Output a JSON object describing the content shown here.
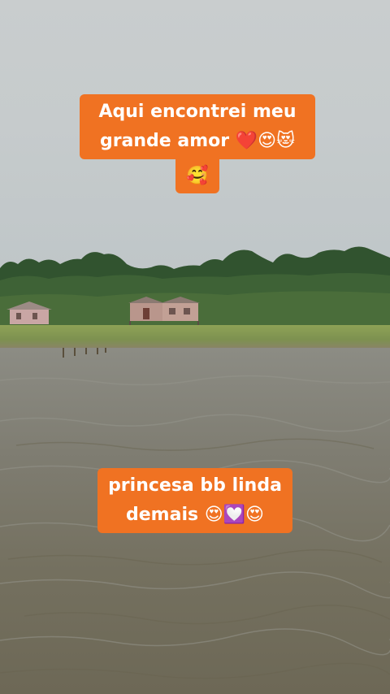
{
  "captions": {
    "top_line1": "Aqui encontrei meu",
    "top_line2": "grande amor ❤️😍😻",
    "top_line3": "🥰",
    "bottom_line1": "princesa bb linda",
    "bottom_line2": "demais 😍💟😍"
  },
  "colors": {
    "caption_background": "#f07222",
    "caption_text": "#ffffff"
  }
}
